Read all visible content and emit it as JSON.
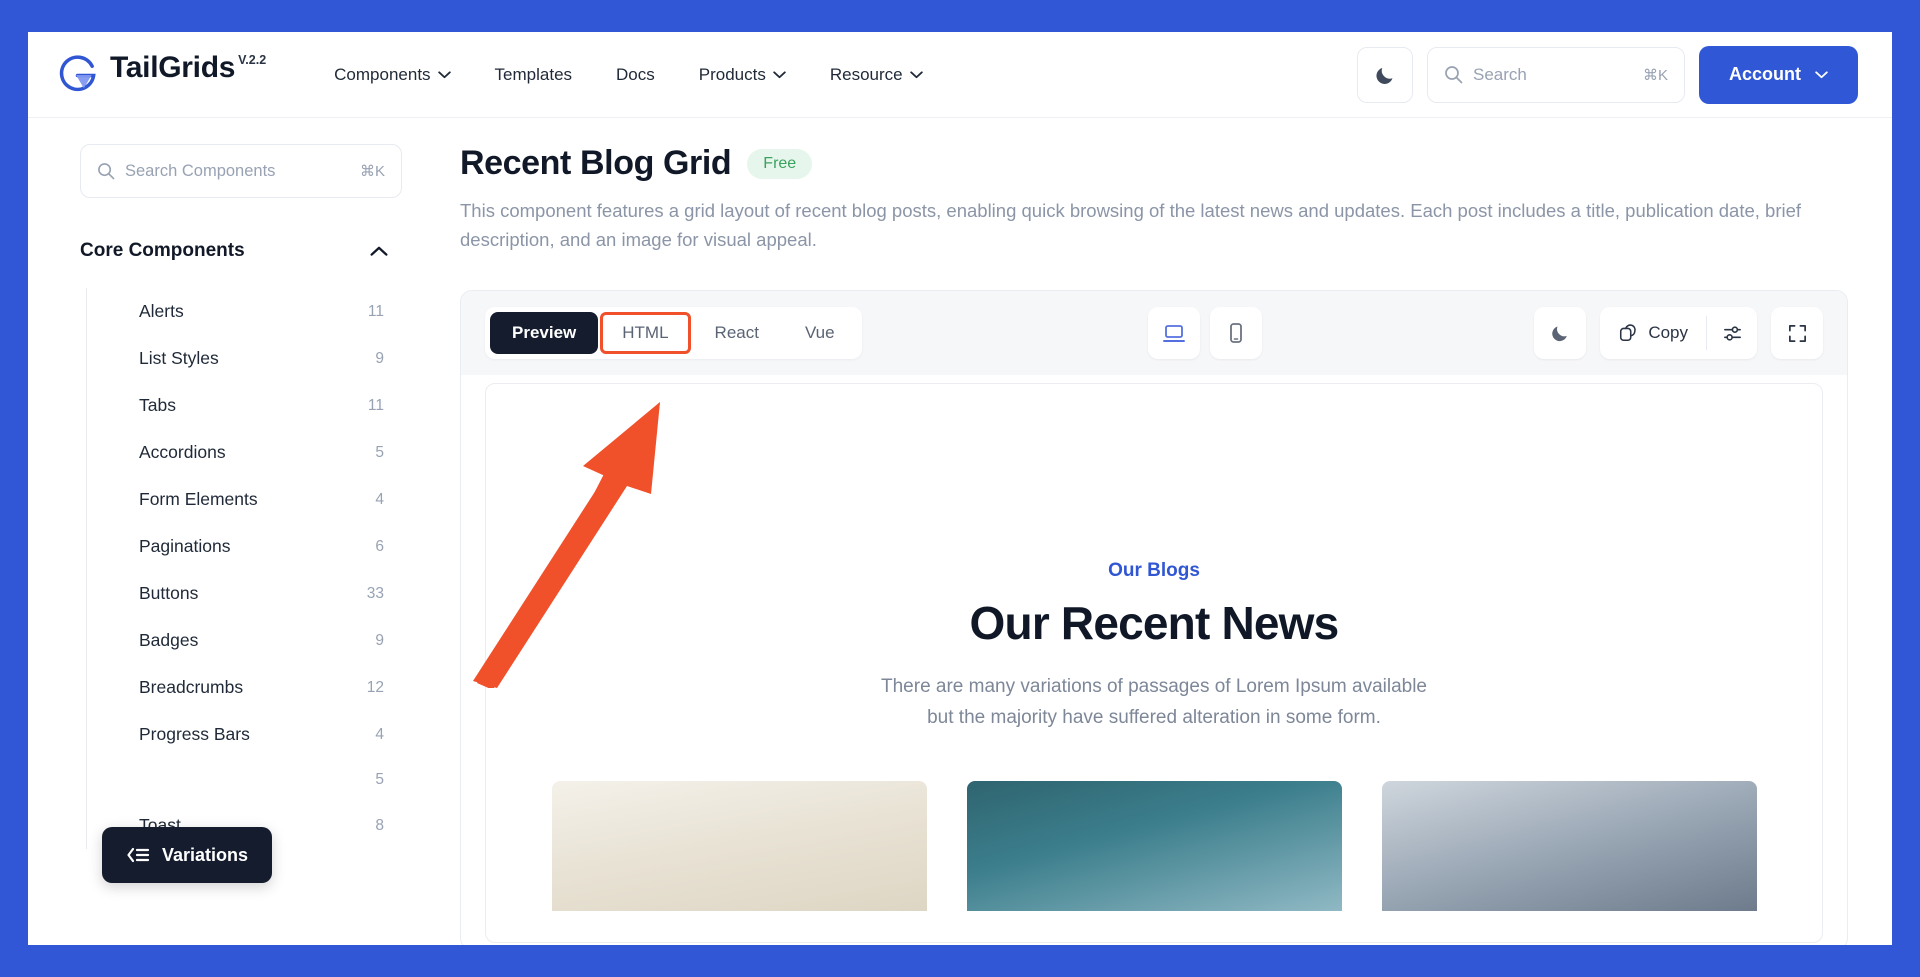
{
  "brand": {
    "name": "TailGrids",
    "version": "V.2.2",
    "logo_icon": "tailgrids-g-logo"
  },
  "topnav": {
    "links": [
      {
        "label": "Components",
        "has_dropdown": true
      },
      {
        "label": "Templates",
        "has_dropdown": false
      },
      {
        "label": "Docs",
        "has_dropdown": false
      },
      {
        "label": "Products",
        "has_dropdown": true
      },
      {
        "label": "Resource",
        "has_dropdown": true
      }
    ],
    "dark_mode_icon": "moon-icon",
    "search": {
      "placeholder": "Search",
      "value": "",
      "shortcut": "⌘K",
      "icon": "search-icon"
    },
    "account_label": "Account"
  },
  "sidebar": {
    "search": {
      "placeholder": "Search Components",
      "value": "",
      "shortcut": "⌘K",
      "icon": "search-icon"
    },
    "group_title": "Core Components",
    "group_collapse_icon": "chevron-up-icon",
    "items": [
      {
        "label": "Alerts",
        "count": "11"
      },
      {
        "label": "List Styles",
        "count": "9"
      },
      {
        "label": "Tabs",
        "count": "11"
      },
      {
        "label": "Accordions",
        "count": "5"
      },
      {
        "label": "Form Elements",
        "count": "4"
      },
      {
        "label": "Paginations",
        "count": "6"
      },
      {
        "label": "Buttons",
        "count": "33"
      },
      {
        "label": "Badges",
        "count": "9"
      },
      {
        "label": "Breadcrumbs",
        "count": "12"
      },
      {
        "label": "Progress Bars",
        "count": "4"
      },
      {
        "label": "",
        "count": "5"
      },
      {
        "label": "Toast",
        "count": "8"
      }
    ],
    "variations_button": {
      "label": "Variations",
      "icon": "collapse-menu-icon"
    }
  },
  "main": {
    "title": "Recent Blog Grid",
    "badge": "Free",
    "description": "This component features a grid layout of recent blog posts, enabling quick browsing of the latest news and updates. Each post includes a title, publication date, brief description, and an image for visual appeal.",
    "toolbar": {
      "tabs": [
        {
          "label": "Preview",
          "state": "active"
        },
        {
          "label": "HTML",
          "state": "highlighted"
        },
        {
          "label": "React",
          "state": "default"
        },
        {
          "label": "Vue",
          "state": "default"
        }
      ],
      "devices": [
        {
          "name": "desktop-view",
          "icon": "desktop-icon",
          "active": true
        },
        {
          "name": "mobile-view",
          "icon": "mobile-icon",
          "active": false
        }
      ],
      "dark_mode_icon": "moon-icon",
      "copy_label": "Copy",
      "copy_icon": "copy-icon",
      "settings_icon": "sliders-icon",
      "fullscreen_icon": "expand-icon"
    },
    "preview": {
      "eyebrow": "Our Blogs",
      "heading": "Our Recent News",
      "subtext_line1": "There are many variations of passages of Lorem Ipsum available",
      "subtext_line2": "but the majority have suffered alteration in some form.",
      "cards": [
        {
          "image_name": "blog-image-interior"
        },
        {
          "image_name": "blog-image-teal-office"
        },
        {
          "image_name": "blog-image-people"
        }
      ]
    }
  },
  "annotation": {
    "arrow_color": "#F0502A",
    "arrow_target": "html-tab",
    "highlight_color": "#F0502A"
  },
  "colors": {
    "page_background": "#3257D6",
    "brand_blue": "#3056D3",
    "accent_dark": "#141C2E",
    "badge_green_text": "#3AA35E",
    "badge_green_bg": "#E7F6EC"
  }
}
